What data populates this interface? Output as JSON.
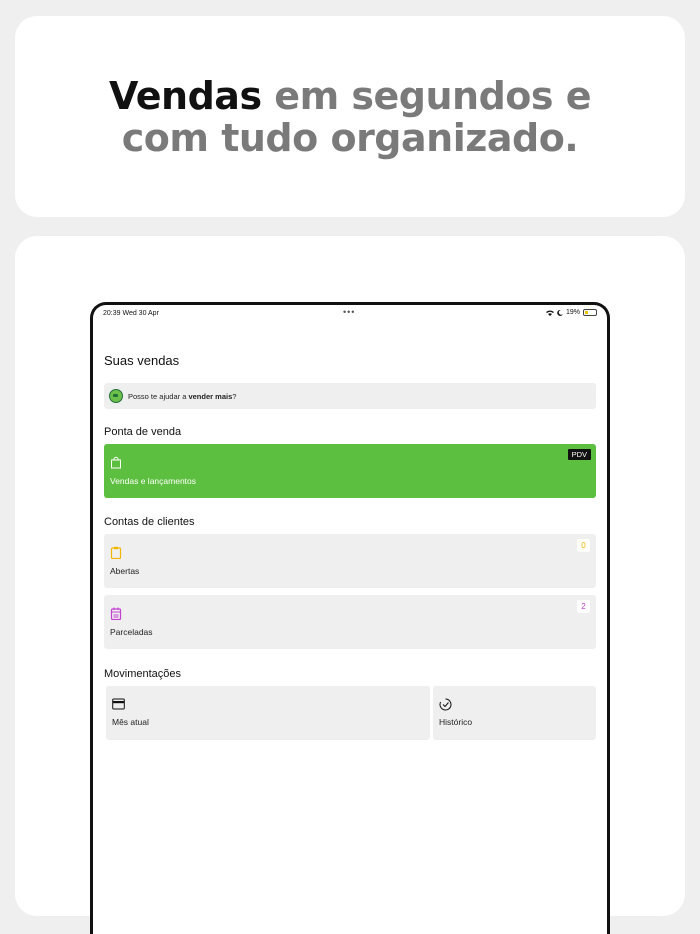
{
  "headline": {
    "strong": "Vendas",
    "rest_line1": " em segundos e",
    "line2": "com tudo organizado."
  },
  "status_bar": {
    "time": "20:39  Wed 30 Apr",
    "dots": "•••",
    "battery": "19%"
  },
  "page": {
    "title": "Suas vendas"
  },
  "assist": {
    "text_before": "Posso te ajudar a ",
    "text_bold": "vender mais",
    "text_after": "?"
  },
  "sections": {
    "pos_title": "Ponta de venda",
    "accounts_title": "Contas de clientes",
    "movements_title": "Movimentações"
  },
  "pos_card": {
    "label": "Vendas e lançamentos",
    "badge": "PDV",
    "color": "#5dbf3f",
    "icon": "bag-icon"
  },
  "open_card": {
    "label": "Abertas",
    "count": "0",
    "color": "#f2b600",
    "icon": "clipboard-icon"
  },
  "installments_card": {
    "label": "Parceladas",
    "count": "2",
    "color": "#c23fd0",
    "icon": "calendar-icon"
  },
  "month_card": {
    "label": "Mês atual",
    "icon": "card-icon"
  },
  "history_card": {
    "label": "Histórico",
    "icon": "history-icon"
  }
}
